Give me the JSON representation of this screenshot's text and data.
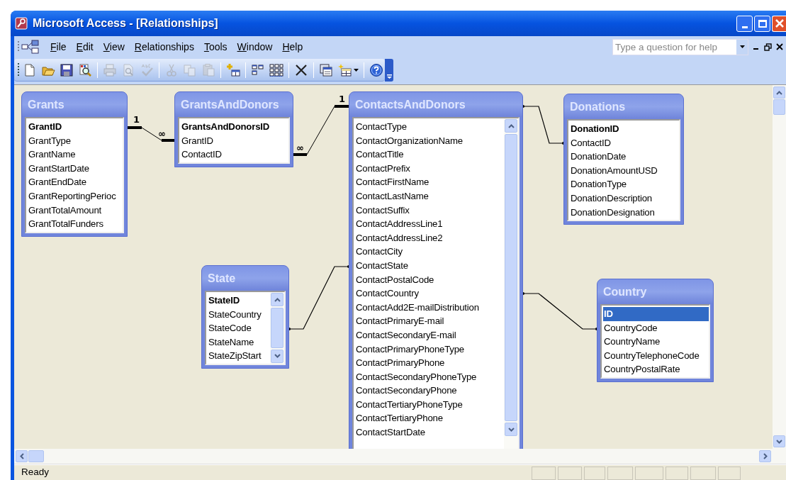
{
  "window": {
    "title": "Microsoft Access - [Relationships]"
  },
  "menu": [
    {
      "label": "File"
    },
    {
      "label": "Edit"
    },
    {
      "label": "View"
    },
    {
      "label": "Relationships"
    },
    {
      "label": "Tools"
    },
    {
      "label": "Window"
    },
    {
      "label": "Help"
    }
  ],
  "help_box": {
    "placeholder": "Type a question for help"
  },
  "toolbar": [
    {
      "kind": "button",
      "disabled": false
    },
    {
      "kind": "button",
      "disabled": false
    },
    {
      "kind": "button",
      "disabled": false
    },
    {
      "kind": "button",
      "disabled": false
    },
    {
      "kind": "separator"
    },
    {
      "kind": "button",
      "disabled": true
    },
    {
      "kind": "button",
      "disabled": true
    },
    {
      "kind": "button",
      "disabled": true
    },
    {
      "kind": "separator"
    },
    {
      "kind": "button",
      "disabled": true
    },
    {
      "kind": "button",
      "disabled": true
    },
    {
      "kind": "button",
      "disabled": true
    },
    {
      "kind": "separator"
    },
    {
      "kind": "button",
      "disabled": false
    },
    {
      "kind": "separator"
    },
    {
      "kind": "button",
      "disabled": false
    },
    {
      "kind": "button",
      "disabled": false
    },
    {
      "kind": "separator"
    },
    {
      "kind": "button",
      "disabled": false
    },
    {
      "kind": "separator"
    },
    {
      "kind": "button",
      "disabled": false
    },
    {
      "kind": "dropdown",
      "disabled": false
    },
    {
      "kind": "separator"
    },
    {
      "kind": "button",
      "disabled": false
    }
  ],
  "tables": [
    {
      "name": "Grants",
      "scrollable": false,
      "fields": [
        {
          "name": "GrantID",
          "primary_key": true,
          "selected": false
        },
        {
          "name": "GrantType",
          "primary_key": false,
          "selected": false
        },
        {
          "name": "GrantName",
          "primary_key": false,
          "selected": false
        },
        {
          "name": "GrantStartDate",
          "primary_key": false,
          "selected": false
        },
        {
          "name": "GrantEndDate",
          "primary_key": false,
          "selected": false
        },
        {
          "name": "GrantReportingPerioc",
          "primary_key": false,
          "selected": false
        },
        {
          "name": "GrantTotalAmount",
          "primary_key": false,
          "selected": false
        },
        {
          "name": "GrantTotalFunders",
          "primary_key": false,
          "selected": false
        }
      ]
    },
    {
      "name": "GrantsAndDonors",
      "scrollable": false,
      "fields": [
        {
          "name": "GrantsAndDonorsID",
          "primary_key": true,
          "selected": false
        },
        {
          "name": "GrantID",
          "primary_key": false,
          "selected": false
        },
        {
          "name": "ContactID",
          "primary_key": false,
          "selected": false
        }
      ]
    },
    {
      "name": "ContactsAndDonors",
      "scrollable": true,
      "fields": [
        {
          "name": "ContactType",
          "primary_key": false,
          "selected": false
        },
        {
          "name": "ContactOrganizationName",
          "primary_key": false,
          "selected": false
        },
        {
          "name": "ContactTitle",
          "primary_key": false,
          "selected": false
        },
        {
          "name": "ContactPrefix",
          "primary_key": false,
          "selected": false
        },
        {
          "name": "ContactFirstName",
          "primary_key": false,
          "selected": false
        },
        {
          "name": "ContactLastName",
          "primary_key": false,
          "selected": false
        },
        {
          "name": "ContactSuffix",
          "primary_key": false,
          "selected": false
        },
        {
          "name": "ContactAddressLine1",
          "primary_key": false,
          "selected": false
        },
        {
          "name": "ContactAddressLine2",
          "primary_key": false,
          "selected": false
        },
        {
          "name": "ContactCity",
          "primary_key": false,
          "selected": false
        },
        {
          "name": "ContactState",
          "primary_key": false,
          "selected": false
        },
        {
          "name": "ContactPostalCode",
          "primary_key": false,
          "selected": false
        },
        {
          "name": "ContactCountry",
          "primary_key": false,
          "selected": false
        },
        {
          "name": "ContactAdd2E-mailDistribution",
          "primary_key": false,
          "selected": false
        },
        {
          "name": "ContactPrimaryE-mail",
          "primary_key": false,
          "selected": false
        },
        {
          "name": "ContactSecondaryE-mail",
          "primary_key": false,
          "selected": false
        },
        {
          "name": "ContactPrimaryPhoneType",
          "primary_key": false,
          "selected": false
        },
        {
          "name": "ContactPrimaryPhone",
          "primary_key": false,
          "selected": false
        },
        {
          "name": "ContactSecondaryPhoneType",
          "primary_key": false,
          "selected": false
        },
        {
          "name": "ContactSecondaryPhone",
          "primary_key": false,
          "selected": false
        },
        {
          "name": "ContactTertiaryPhoneType",
          "primary_key": false,
          "selected": false
        },
        {
          "name": "ContactTertiaryPhone",
          "primary_key": false,
          "selected": false
        },
        {
          "name": "ContactStartDate",
          "primary_key": false,
          "selected": false
        }
      ]
    },
    {
      "name": "Donations",
      "scrollable": false,
      "fields": [
        {
          "name": "DonationID",
          "primary_key": true,
          "selected": false
        },
        {
          "name": "ContactID",
          "primary_key": false,
          "selected": false
        },
        {
          "name": "DonationDate",
          "primary_key": false,
          "selected": false
        },
        {
          "name": "DonationAmountUSD",
          "primary_key": false,
          "selected": false
        },
        {
          "name": "DonationType",
          "primary_key": false,
          "selected": false
        },
        {
          "name": "DonationDescription",
          "primary_key": false,
          "selected": false
        },
        {
          "name": "DonationDesignation",
          "primary_key": false,
          "selected": false
        }
      ]
    },
    {
      "name": "State",
      "scrollable": true,
      "fields": [
        {
          "name": "StateID",
          "primary_key": true,
          "selected": false
        },
        {
          "name": "StateCountry",
          "primary_key": false,
          "selected": false
        },
        {
          "name": "StateCode",
          "primary_key": false,
          "selected": false
        },
        {
          "name": "StateName",
          "primary_key": false,
          "selected": false
        },
        {
          "name": "StateZipStart",
          "primary_key": false,
          "selected": false
        }
      ]
    },
    {
      "name": "Country",
      "scrollable": false,
      "fields": [
        {
          "name": "ID",
          "primary_key": true,
          "selected": true
        },
        {
          "name": "CountryCode",
          "primary_key": false,
          "selected": false
        },
        {
          "name": "CountryName",
          "primary_key": false,
          "selected": false
        },
        {
          "name": "CountryTelephoneCode",
          "primary_key": false,
          "selected": false
        },
        {
          "name": "CountryPostalRate",
          "primary_key": false,
          "selected": false
        }
      ]
    }
  ],
  "relationships": [
    {
      "kind": "enforced",
      "start_label": "1",
      "end_label": "∞"
    },
    {
      "kind": "enforced",
      "start_label": "∞",
      "end_label": "1"
    },
    {
      "kind": "plain"
    },
    {
      "kind": "plain"
    },
    {
      "kind": "plain"
    }
  ],
  "status_bar": {
    "text": "Ready"
  }
}
